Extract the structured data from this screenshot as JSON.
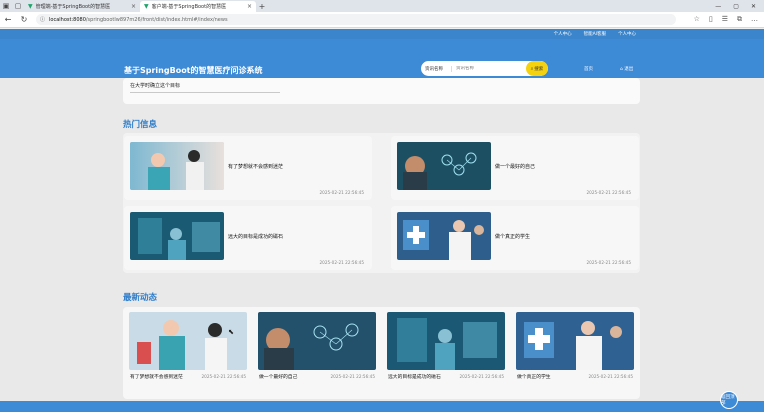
{
  "browser": {
    "tabs": [
      {
        "title": "管理端-基于SpringBoot的智慧医",
        "active": false
      },
      {
        "title": "客户端-基于SpringBoot的智慧医",
        "active": true
      }
    ],
    "url_host": "localhost:8080",
    "url_path": "/springbootlw897m26/front/dist/index.html#/index/news"
  },
  "header": {
    "top_links": [
      "个人中心",
      "智能AI客服",
      "个人中心"
    ],
    "site_title": "基于SpringBoot的智慧医疗问诊系统",
    "search_select": "资讯名称",
    "search_placeholder": "资讯名称",
    "search_button": "搜索",
    "nav_links": [
      "首页",
      "退出"
    ]
  },
  "intro": {
    "text": "在大学时确立这个目标"
  },
  "hot": {
    "title": "热门信息",
    "items": [
      {
        "name": "有了梦想就不会感到迷茫",
        "date": "2025-02-21 22:56:45"
      },
      {
        "name": "做一个最好的自己",
        "date": "2025-02-21 22:56:45"
      },
      {
        "name": "远大的目标是成功的磁石",
        "date": "2025-02-21 22:56:45"
      },
      {
        "name": "做个真正的学生",
        "date": "2025-02-21 22:56:45"
      }
    ]
  },
  "news": {
    "title": "最新动态",
    "items": [
      {
        "name": "有了梦想就不会感到迷茫",
        "date": "2025-02-21 22:56:45"
      },
      {
        "name": "做一个最好的自己",
        "date": "2025-02-21 22:56:45"
      },
      {
        "name": "远大的目标是成功的磁石",
        "date": "2025-02-21 22:56:45"
      },
      {
        "name": "做个真正的学生",
        "date": "2025-02-21 22:56:45"
      }
    ]
  },
  "float_button": "返回顶部",
  "colors": {
    "header_blue": "#3d8ad6",
    "section_title": "#2f7dc9",
    "search_button": "#f5d20f"
  },
  "icons": [
    "back-icon",
    "refresh-icon",
    "info-icon",
    "star-icon",
    "close-icon",
    "plus-icon",
    "cursor-icon"
  ]
}
